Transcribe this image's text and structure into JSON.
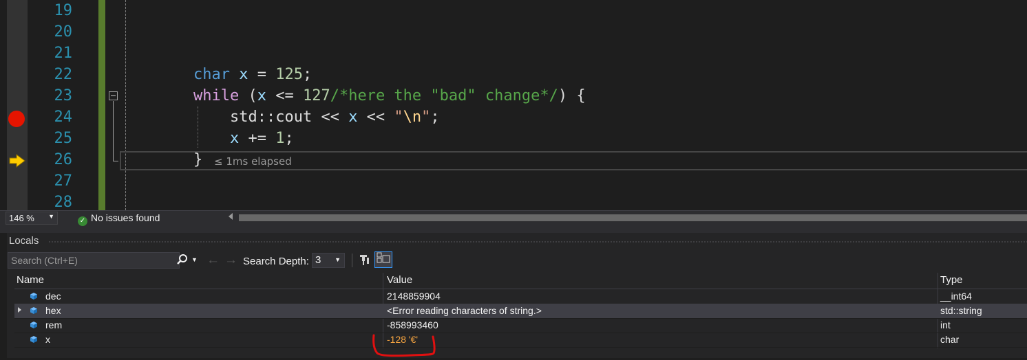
{
  "editor": {
    "line_numbers": [
      "19",
      "20",
      "21",
      "22",
      "23",
      "24",
      "25",
      "26",
      "27",
      "28"
    ],
    "lines": {
      "l22": {
        "kw": "char",
        "var": "x",
        "op": " = ",
        "num": "125",
        "end": ";"
      },
      "l23": {
        "kw": "while",
        "open": " (",
        "var": "x",
        "op": " <= ",
        "num": "127",
        "cmt": "/*here the \"bad\" change*/",
        "end": ") {"
      },
      "l24": {
        "ns": "std::cout << ",
        "var": "x",
        "op": " << ",
        "str_open": "\"",
        "esc": "\\n",
        "str_close": "\"",
        "end": ";"
      },
      "l25": {
        "var": "x",
        "op": " += ",
        "num": "1",
        "end": ";"
      },
      "l26": {
        "brace": "}"
      }
    },
    "elapsed": "≤ 1ms elapsed",
    "breakpoint_line": "24",
    "current_line": "26"
  },
  "status": {
    "zoom": "146 %",
    "issues": "No issues found"
  },
  "locals": {
    "title": "Locals",
    "search_placeholder": "Search (Ctrl+E)",
    "search_depth_label": "Search Depth:",
    "search_depth_value": "3",
    "columns": {
      "name": "Name",
      "value": "Value",
      "type": "Type"
    },
    "rows": [
      {
        "name": "dec",
        "value": "2148859904",
        "type": "__int64"
      },
      {
        "name": "hex",
        "value": "<Error reading characters of string.>",
        "type": "std::string"
      },
      {
        "name": "rem",
        "value": "-858993460",
        "type": "int"
      },
      {
        "name": "x",
        "value": "-128 '€'",
        "type": "char"
      }
    ]
  },
  "colors": {
    "background": "#1e1e1e",
    "line_number": "#2b91af",
    "keyword": "#569cd6",
    "control_keyword": "#d8a0df",
    "number": "#b5cea8",
    "comment": "#57a64a",
    "changed_value": "#f7a541",
    "breakpoint": "#e51400",
    "annotation": "#e01010"
  }
}
